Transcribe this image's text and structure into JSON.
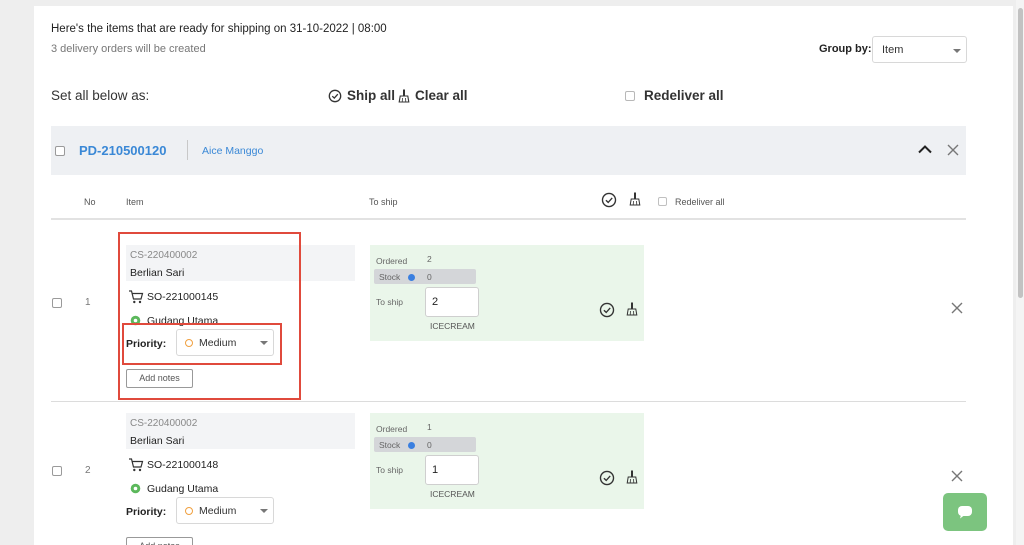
{
  "header": {
    "title": "Here's the items that are ready for shipping on 31-10-2022 | 08:00",
    "subtitle": "3 delivery orders will be created",
    "group_by_label": "Group by:",
    "group_by_value": "Item"
  },
  "bulk": {
    "set_all_label": "Set all below as:",
    "ship_all": "Ship all",
    "clear_all": "Clear all",
    "redeliver_all": "Redeliver all"
  },
  "group": {
    "code": "PD-210500120",
    "customer": "Aice Manggo"
  },
  "columns": {
    "no": "No",
    "item": "Item",
    "to_ship": "To ship",
    "redeliver_all": "Redeliver all"
  },
  "rows": [
    {
      "no": "1",
      "item_code": "CS-220400002",
      "item_name": "Berlian Sari",
      "so": "SO-221000145",
      "warehouse": "Gudang Utama",
      "priority_label": "Priority:",
      "priority": "Medium",
      "notes_button": "Add notes",
      "ordered_label": "Ordered",
      "ordered": "2",
      "stock_label": "Stock",
      "stock": "0",
      "to_ship_label": "To ship",
      "to_ship": "2",
      "unit": "ICECREAM"
    },
    {
      "no": "2",
      "item_code": "CS-220400002",
      "item_name": "Berlian Sari",
      "so": "SO-221000148",
      "warehouse": "Gudang Utama",
      "priority_label": "Priority:",
      "priority": "Medium",
      "notes_button": "Add notes",
      "ordered_label": "Ordered",
      "ordered": "1",
      "stock_label": "Stock",
      "stock": "0",
      "to_ship_label": "To ship",
      "to_ship": "1",
      "unit": "ICECREAM"
    }
  ],
  "colors": {
    "link": "#3a88d6",
    "ship_box": "#eaf6ea",
    "highlight": "#e04a3c",
    "stock_dot": "#3a7fe0",
    "priority_medium": "#f0a040",
    "location_pin": "#5cb85c",
    "chat_button": "#7cc47f"
  },
  "icons": {
    "ship": "check-circle-icon",
    "clear": "broom-icon",
    "collapse": "chevron-up-icon",
    "close": "close-icon",
    "cart": "cart-icon",
    "location": "location-pin-icon",
    "chat": "chat-bubble-icon"
  }
}
